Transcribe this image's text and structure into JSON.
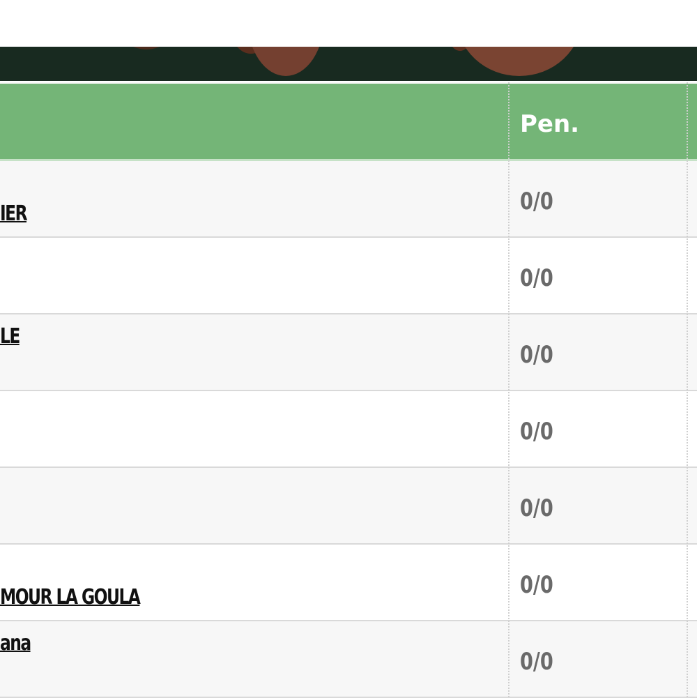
{
  "header": {
    "pen_label": "Pen."
  },
  "rows": [
    {
      "name": "IER",
      "name_pos": "low",
      "pen": "0/0"
    },
    {
      "name": "",
      "name_pos": "low",
      "pen": "0/0"
    },
    {
      "name": "LE",
      "name_pos": "high",
      "pen": "0/0"
    },
    {
      "name": "",
      "name_pos": "low",
      "pen": "0/0"
    },
    {
      "name": "",
      "name_pos": "low",
      "pen": "0/0"
    },
    {
      "name": "MOUR LA GOULA",
      "name_pos": "low",
      "pen": "0/0"
    },
    {
      "name": "ana",
      "name_pos": "high",
      "pen": "0/0"
    }
  ],
  "colors": {
    "banner": "#182a20",
    "header": "#74b577",
    "pen_text": "#6a6a6a"
  }
}
